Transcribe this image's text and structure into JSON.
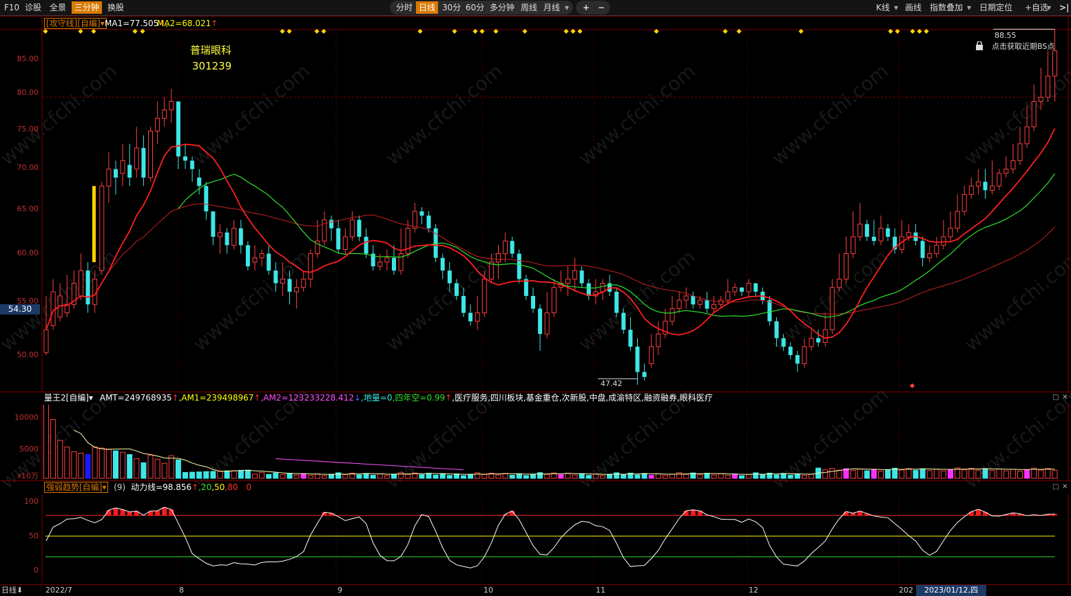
{
  "toolbar": {
    "left": [
      "F10",
      "诊股",
      "全景",
      "三分钟",
      "换股"
    ],
    "left_active": "三分钟",
    "periods": [
      "分时",
      "日线",
      "30分",
      "60分",
      "多分钟",
      "周线",
      "月线"
    ],
    "period_active": "日线",
    "zoom_in": "+",
    "zoom_out": "−",
    "right": [
      "K线",
      "画线",
      "指数叠加",
      "日期定位",
      "+自选"
    ],
    "collapse": ">|"
  },
  "main_header": {
    "indicator": "[攻守线][自编]",
    "ma1": "MA1=77.505",
    "ma2": "MA2=68.021"
  },
  "stock": {
    "name": "普瑞眼科",
    "code": "301239"
  },
  "main_y_ticks": [
    "85.00",
    "80.00",
    "75.00",
    "70.00",
    "65.00",
    "60.00",
    "55.00",
    "50.00"
  ],
  "price_tag": "54.30",
  "high_label": "88.55",
  "low_label": "47.42",
  "bs_hint": "点击获取近期BS点",
  "vol_header": {
    "indicator": "量王2[自编]",
    "amt": "AMT=249768935",
    "am1": "AM1=239498967",
    "am2": "AM2=123233228.412",
    "diliang": "地量=0",
    "sinian": "四年空=0.99",
    "sectors": "医疗服务,四川板块,基金重仓,次新股,中盘,成渝特区,融资融券,眼科医疗"
  },
  "vol_y_ticks": [
    "10000",
    "5000"
  ],
  "vol_unit": "x10万",
  "osc_header": {
    "indicator": "强弱趋势[自编]",
    "param": "(9)",
    "value": "动力线=98.856",
    "l20": "20",
    "l50": "50",
    "l80": "80",
    "zero": "0"
  },
  "osc_y_ticks": [
    "100",
    "50",
    "0"
  ],
  "x_ticks": [
    "2022/7",
    "8",
    "9",
    "10",
    "11",
    "12",
    "202"
  ],
  "cursor_date": "2023/01/12,四",
  "bottom_tab": "日线",
  "watermark": "www.cfchi.com",
  "colors": {
    "up": "#ff4040",
    "down": "#3ee6e6",
    "ma_fast": "#ff2020",
    "ma_mid": "#30e030",
    "ma_slow": "#c82020",
    "accent": "#d97a00"
  },
  "chart_data": {
    "type": "candlestick",
    "ylim": [
      46,
      89
    ],
    "candles": [
      [
        50.3,
        53,
        50,
        57
      ],
      [
        53.5,
        57.5,
        53,
        59
      ],
      [
        54.5,
        57,
        54,
        58.5
      ],
      [
        55,
        56,
        54.5,
        59.5
      ],
      [
        56,
        58.5,
        55.5,
        60
      ],
      [
        57,
        60,
        56.5,
        62
      ],
      [
        60,
        56,
        55,
        61
      ],
      [
        56,
        59,
        55,
        60
      ],
      [
        60,
        70,
        59.5,
        70.5
      ],
      [
        70,
        72,
        68,
        74
      ],
      [
        72,
        71,
        69,
        73
      ],
      [
        71.5,
        73,
        70,
        75
      ],
      [
        72.5,
        71,
        70,
        75
      ],
      [
        72,
        74.5,
        71,
        77
      ],
      [
        74.5,
        71,
        70,
        76
      ],
      [
        71,
        76.5,
        70.5,
        77
      ],
      [
        76.5,
        78,
        75,
        80
      ],
      [
        78,
        79,
        77,
        80.5
      ],
      [
        79,
        80,
        77.5,
        81.5
      ],
      [
        80,
        73.5,
        72,
        80
      ],
      [
        73.5,
        73,
        72,
        75
      ],
      [
        73,
        72,
        70.5,
        73.5
      ],
      [
        71,
        70,
        69,
        72
      ],
      [
        70,
        67,
        66,
        70.5
      ],
      [
        67,
        64,
        63,
        67
      ],
      [
        64,
        64.5,
        62,
        65.5
      ],
      [
        64.5,
        63,
        62,
        65
      ],
      [
        63,
        65,
        62.5,
        66
      ],
      [
        65,
        63,
        62,
        66
      ],
      [
        63,
        60.5,
        60,
        63.5
      ],
      [
        61,
        61.5,
        60,
        63
      ],
      [
        61.5,
        62,
        60.5,
        62.5
      ],
      [
        62,
        60,
        59.5,
        63
      ],
      [
        60,
        58.5,
        57.5,
        61
      ],
      [
        58.5,
        59,
        57,
        61
      ],
      [
        59,
        57.5,
        56,
        60
      ],
      [
        57.5,
        58,
        55.5,
        59
      ],
      [
        58,
        59,
        57.5,
        60
      ],
      [
        59,
        62,
        58,
        62.5
      ],
      [
        62,
        63.5,
        61.5,
        66
      ],
      [
        63.5,
        66,
        63,
        67
      ],
      [
        66,
        65,
        63.5,
        66.5
      ],
      [
        65,
        62.5,
        62,
        66
      ],
      [
        62.5,
        64,
        62,
        65
      ],
      [
        64,
        66,
        63.5,
        67
      ],
      [
        66,
        64,
        63.5,
        66.5
      ],
      [
        64,
        62,
        61.5,
        65
      ],
      [
        62,
        60.5,
        60,
        63
      ],
      [
        60.5,
        61,
        60,
        62
      ],
      [
        61,
        61.5,
        60,
        62.5
      ],
      [
        61.5,
        60,
        59.5,
        63
      ],
      [
        60,
        62,
        59.5,
        65
      ],
      [
        62,
        65,
        61.5,
        66
      ],
      [
        65,
        67,
        64.5,
        68
      ],
      [
        67,
        66.5,
        65.5,
        67.5
      ],
      [
        66.5,
        65,
        64.5,
        67
      ],
      [
        65,
        61.5,
        61,
        65.5
      ],
      [
        61.5,
        60,
        59,
        62
      ],
      [
        60,
        58.5,
        57.5,
        61
      ],
      [
        58.5,
        57,
        56.5,
        59
      ],
      [
        57,
        55,
        54.5,
        58
      ],
      [
        55,
        54,
        53.5,
        56
      ],
      [
        54,
        55,
        53,
        57
      ],
      [
        55,
        59,
        54.5,
        60
      ],
      [
        59,
        61,
        58.5,
        62
      ],
      [
        61,
        62,
        59,
        63
      ],
      [
        62,
        63.5,
        61,
        64.5
      ],
      [
        63.5,
        62,
        61.5,
        64
      ],
      [
        62,
        59,
        58.5,
        62.5
      ],
      [
        59,
        57,
        56.5,
        59.5
      ],
      [
        57,
        55.5,
        55,
        58
      ],
      [
        55.5,
        52.5,
        50.5,
        56
      ],
      [
        52.5,
        55,
        52,
        57.5
      ],
      [
        55,
        58,
        54.5,
        59
      ],
      [
        58,
        58.5,
        57.5,
        60
      ],
      [
        58.5,
        59,
        57,
        60.5
      ],
      [
        59,
        60,
        57.5,
        61.5
      ],
      [
        60,
        58.5,
        58,
        60.5
      ],
      [
        58.5,
        57,
        56.5,
        59
      ],
      [
        57,
        57.5,
        56,
        59
      ],
      [
        57.5,
        58.5,
        56.5,
        59
      ],
      [
        58.5,
        57.5,
        57,
        59.5
      ],
      [
        57.5,
        55,
        54.5,
        58
      ],
      [
        55,
        53,
        52.5,
        55.5
      ],
      [
        53,
        51,
        50.5,
        54.5
      ],
      [
        51,
        48,
        46.5,
        52
      ],
      [
        48,
        47.42,
        47,
        49
      ],
      [
        49,
        51,
        48.5,
        52.5
      ],
      [
        51,
        52.5,
        50,
        54
      ],
      [
        52.5,
        54,
        52,
        55.5
      ],
      [
        54,
        55.5,
        53.5,
        57
      ],
      [
        55.5,
        56.5,
        55,
        57.5
      ],
      [
        56.5,
        57,
        55.5,
        58
      ],
      [
        57,
        56,
        55.5,
        57.5
      ],
      [
        56,
        56.5,
        55.5,
        57
      ],
      [
        56.5,
        55.5,
        55,
        57.5
      ],
      [
        55.5,
        56,
        55,
        57
      ],
      [
        56,
        56.5,
        55.5,
        57
      ],
      [
        56.5,
        57.5,
        56,
        59
      ],
      [
        57.5,
        58,
        57,
        58.5
      ],
      [
        58,
        57.5,
        57,
        58
      ],
      [
        57.5,
        58.5,
        57,
        59
      ],
      [
        58.5,
        57.5,
        57,
        58.5
      ],
      [
        57.5,
        56.5,
        56,
        58
      ],
      [
        56.5,
        54,
        53.5,
        57
      ],
      [
        54,
        52,
        51,
        54.5
      ],
      [
        52,
        51,
        50.5,
        52.5
      ],
      [
        51,
        50,
        49.5,
        51.5
      ],
      [
        50,
        49,
        48,
        50.5
      ],
      [
        49,
        51,
        48.5,
        52
      ],
      [
        51,
        52,
        50.5,
        53
      ],
      [
        52,
        51.5,
        51,
        53
      ],
      [
        51.5,
        53,
        51,
        55
      ],
      [
        53,
        58,
        52.5,
        59
      ],
      [
        58,
        59,
        57.5,
        62
      ],
      [
        59,
        62,
        58.5,
        64
      ],
      [
        62,
        64,
        61.5,
        67
      ],
      [
        64,
        65.5,
        63.5,
        68
      ],
      [
        65.5,
        64,
        63.5,
        66
      ],
      [
        64,
        63.5,
        63,
        66
      ],
      [
        63.5,
        65,
        63,
        66.5
      ],
      [
        65,
        64,
        63.5,
        65.5
      ],
      [
        64,
        62.5,
        62,
        65
      ],
      [
        62.5,
        64,
        62,
        66
      ],
      [
        64,
        64.5,
        63.5,
        65.5
      ],
      [
        64.5,
        63.5,
        63,
        65.5
      ],
      [
        63.5,
        61.5,
        60.5,
        64
      ],
      [
        61.5,
        62,
        61,
        63
      ],
      [
        62,
        63,
        61.5,
        64
      ],
      [
        63,
        64,
        62.5,
        66
      ],
      [
        64,
        65,
        63.5,
        67
      ],
      [
        65,
        67,
        64.5,
        69
      ],
      [
        67,
        69,
        66.5,
        70
      ],
      [
        69,
        70,
        68.5,
        71
      ],
      [
        70,
        70.5,
        69,
        72
      ],
      [
        70.5,
        69.5,
        68.5,
        72
      ],
      [
        69.5,
        70,
        69,
        73
      ],
      [
        70,
        71.5,
        69.5,
        72
      ],
      [
        71.5,
        72,
        71,
        73.5
      ],
      [
        72,
        73,
        71.5,
        75
      ],
      [
        73,
        75,
        72.5,
        77
      ],
      [
        75,
        77,
        74.5,
        79.5
      ],
      [
        77,
        80,
        76.5,
        82
      ],
      [
        80,
        80.5,
        79,
        84
      ],
      [
        80.5,
        83,
        80,
        86
      ],
      [
        83,
        86,
        80,
        88.55
      ]
    ]
  }
}
